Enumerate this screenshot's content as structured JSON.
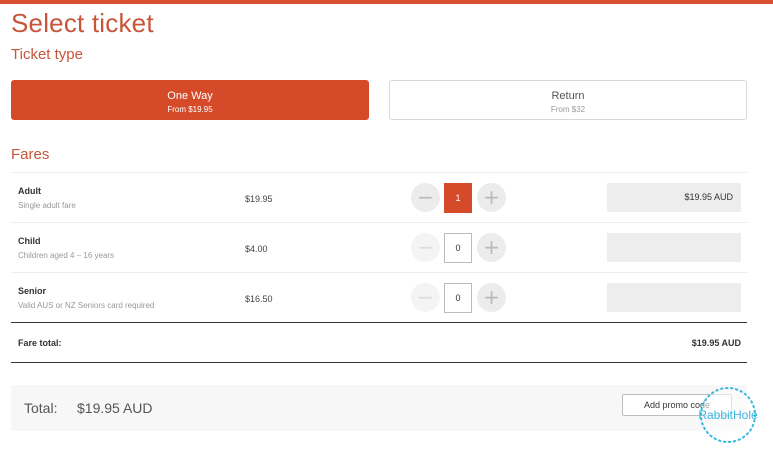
{
  "page": {
    "title": "Select ticket"
  },
  "ticket_type": {
    "heading": "Ticket type",
    "options": [
      {
        "label": "One Way",
        "sub": "From $19.95",
        "selected": true
      },
      {
        "label": "Return",
        "sub": "From $32",
        "selected": false
      }
    ]
  },
  "fares": {
    "heading": "Fares",
    "rows": [
      {
        "name": "Adult",
        "desc": "Single adult fare",
        "price": "$19.95",
        "qty": "1",
        "subtotal": "$19.95 AUD",
        "minus": "−",
        "plus": "+"
      },
      {
        "name": "Child",
        "desc": "Children aged 4 – 16 years",
        "price": "$4.00",
        "qty": "0",
        "subtotal": "",
        "minus": "−",
        "plus": "+"
      },
      {
        "name": "Senior",
        "desc": "Valid AUS or NZ Seniors card required",
        "price": "$16.50",
        "qty": "0",
        "subtotal": "",
        "minus": "−",
        "plus": "+"
      }
    ],
    "total_label": "Fare total:",
    "total_value": "$19.95 AUD"
  },
  "summary": {
    "label": "Total:",
    "value": "$19.95 AUD",
    "promo_button": "Add promo code"
  },
  "watermark": {
    "text": "RabbitHole"
  },
  "colors": {
    "accent": "#d54b2a",
    "heading": "#c8553a",
    "watermark": "#3ab7e0"
  }
}
